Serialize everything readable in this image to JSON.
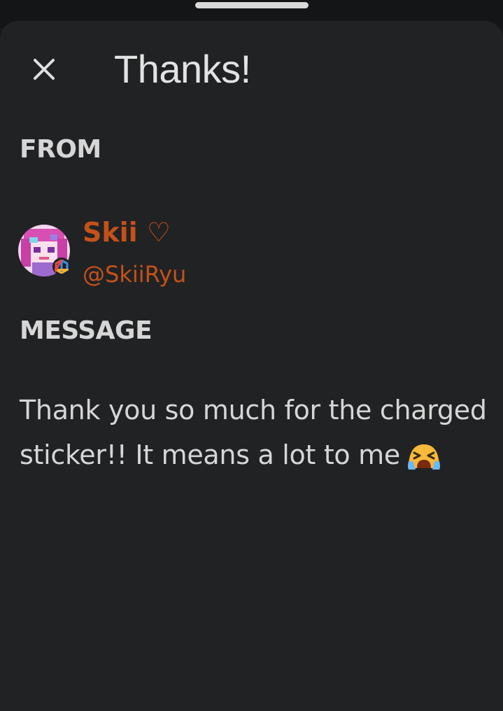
{
  "header": {
    "title": "Thanks!",
    "close_icon": "close-icon"
  },
  "from": {
    "label": "FROM",
    "display_name": "Skii ♡",
    "handle": "@SkiiRyu",
    "avatar_icon": "avatar",
    "badge_icon": "hexagon-badge-icon"
  },
  "message": {
    "label": "MESSAGE",
    "text": "Thank you so much for the charged sticker!! It means a lot to me",
    "emoji_icon": "crying-face-emoji-icon"
  },
  "colors": {
    "background": "#212224",
    "accent": "#c4511a",
    "text": "#d6d6d6",
    "title": "#e3e3e3"
  }
}
